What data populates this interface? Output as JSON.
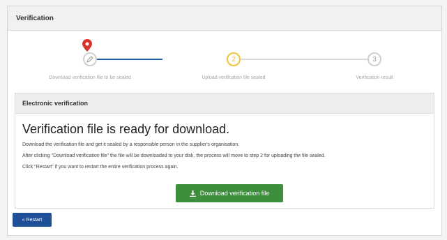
{
  "panel": {
    "title": "Verification"
  },
  "steps": [
    {
      "number": "",
      "label": "Download verification file to be sealed",
      "state": "done"
    },
    {
      "number": "2",
      "label": "Upload verification file sealed",
      "state": "active"
    },
    {
      "number": "3",
      "label": "Verification result",
      "state": "pending"
    }
  ],
  "section": {
    "title": "Electronic verification",
    "heading": "Verification file is ready for download.",
    "paragraphs": [
      "Download the verification file and get it sealed by a responsible person in the supplier's organisation.",
      "After clicking \"Download verification file\" the file will be downloaded to your disk, the process will move to step 2 for uploading the file sealed.",
      "Click \"Restart\" if you want to restart the entire verification process again."
    ],
    "download_button": "Download verification file"
  },
  "restart_button": "« Restart",
  "colors": {
    "done_line": "#2a62a8",
    "active_step": "#f0c23b",
    "pin": "#d9322d",
    "download_button": "#3e8e3e",
    "restart_button": "#1f4f98"
  },
  "icons": {
    "step1": "pencil-icon",
    "marker": "map-pin-icon",
    "download": "download-icon"
  }
}
